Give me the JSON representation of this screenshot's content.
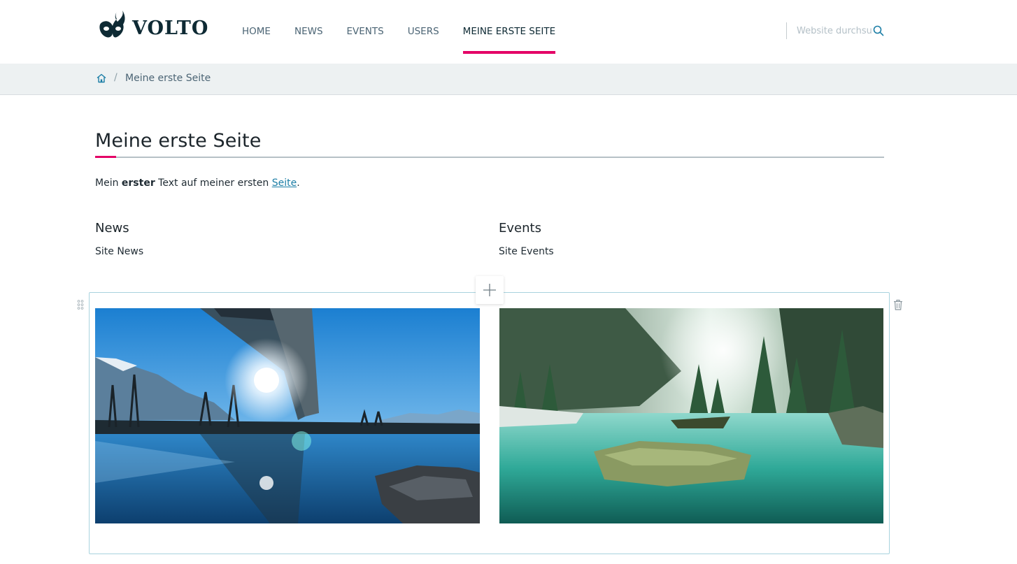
{
  "header": {
    "logo_text": "VOLTO",
    "nav": [
      "HOME",
      "NEWS",
      "EVENTS",
      "USERS",
      "MEINE ERSTE SEITE"
    ],
    "active_index": 4,
    "search": {
      "placeholder": "Website durchsuchen"
    }
  },
  "breadcrumb": {
    "separator": "/",
    "current": "Meine erste Seite"
  },
  "page": {
    "title": "Meine erste Seite",
    "intro": {
      "prefix": "Mein ",
      "bold": "erster",
      "middle": " Text auf meiner ersten ",
      "link": "Seite",
      "suffix": "."
    }
  },
  "columns": [
    {
      "title": "News",
      "text": "Site News"
    },
    {
      "title": "Events",
      "text": "Site Events"
    }
  ],
  "images": [
    {
      "name": "image-bridge-lake"
    },
    {
      "name": "image-forest-lake"
    }
  ],
  "colors": {
    "accent": "#e40166",
    "link": "#1c7ea6",
    "block_border": "#a8d3de"
  }
}
